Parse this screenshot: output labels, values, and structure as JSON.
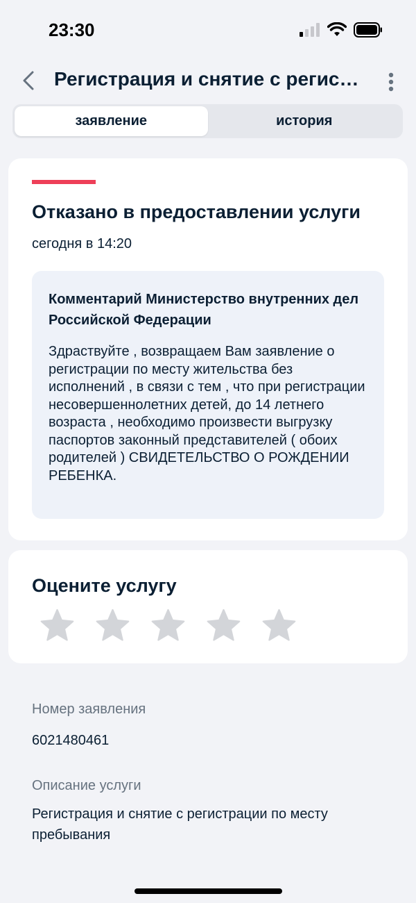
{
  "status_bar": {
    "time": "23:30"
  },
  "header": {
    "title": "Регистрация и снятие с регистрации по месту пребывания"
  },
  "tabs": [
    {
      "label": "заявление",
      "active": true
    },
    {
      "label": "история",
      "active": false
    }
  ],
  "status_card": {
    "title": "Отказано в предоставлении услуги",
    "date": "сегодня в 14:20",
    "accent_color": "#ee3f58",
    "comment": {
      "title": "Комментарий Министерство внутренних дел Российской Федерации",
      "text": "Здраствуйте , возвращаем Вам заявление о регистрации по месту жительства без исполнений , в связи с тем , что при регистрации несовершеннолетних детей, до 14 летнего возраста , необходимо произвести выгрузку паспортов законный представителей ( обоих родителей ) СВИДЕТЕЛЬСТВО О РОЖДЕНИИ РЕБЕНКА."
    }
  },
  "rating": {
    "title": "Оцените услугу",
    "stars_total": 5,
    "stars_selected": 0
  },
  "details": {
    "number_label": "Номер заявления",
    "number_value": "6021480461",
    "description_label": "Описание услуги",
    "description_value": "Регистрация и снятие с регистрации по месту пребывания"
  }
}
